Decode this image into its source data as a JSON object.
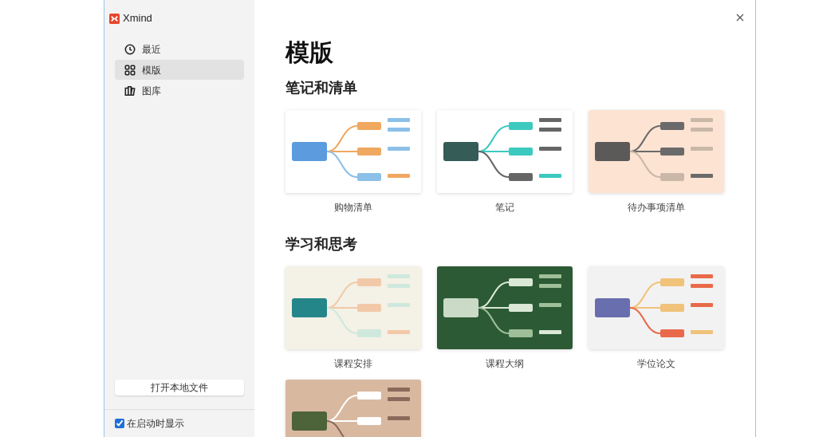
{
  "app": {
    "name": "Xmind"
  },
  "sidebar": {
    "items": [
      {
        "label": "最近",
        "selected": false
      },
      {
        "label": "模版",
        "selected": true
      },
      {
        "label": "图库",
        "selected": false
      }
    ],
    "open_button": "打开本地文件",
    "show_on_startup": {
      "label": "在启动时显示",
      "checked": true
    }
  },
  "title": "模版",
  "sections": [
    {
      "heading": "笔记和清单",
      "templates": [
        {
          "name": "购物清单",
          "kind": "picture"
        },
        {
          "name": "笔记",
          "kind": "picture"
        },
        {
          "name": "待办事项清单",
          "kind": "picture"
        }
      ]
    },
    {
      "heading": "学习和思考",
      "templates": [
        {
          "name": "课程安排",
          "kind": "picture"
        },
        {
          "name": "课程大纲",
          "kind": "picture"
        },
        {
          "name": "学位论文",
          "kind": "picture"
        },
        {
          "kind": "picture"
        }
      ]
    }
  ]
}
